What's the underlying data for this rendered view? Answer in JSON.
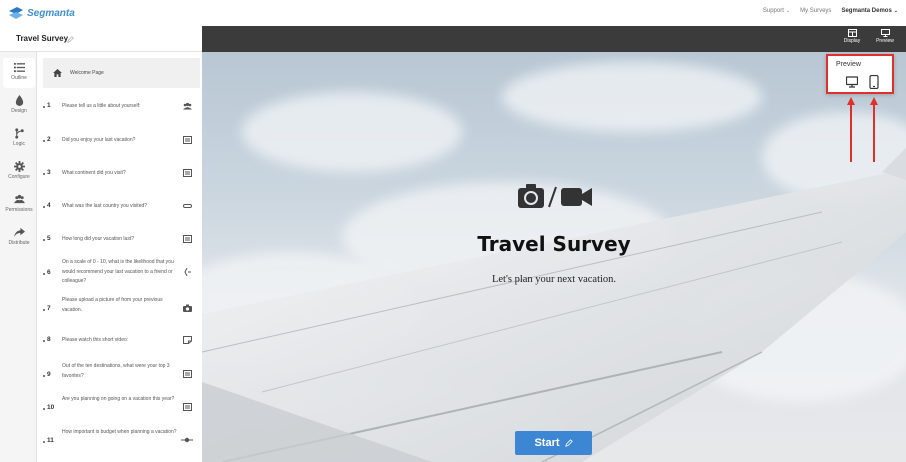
{
  "brand": {
    "name": "Segmanta",
    "color": "#3d8fd6"
  },
  "topnav": {
    "support": "Support",
    "my_surveys": "My Surveys",
    "account": "Segmanta Demos"
  },
  "survey": {
    "title": "Travel Survey"
  },
  "sidenav": [
    {
      "label": "Outline",
      "icon": "outline-icon",
      "active": true
    },
    {
      "label": "Design",
      "icon": "droplet-icon"
    },
    {
      "label": "Logic",
      "icon": "branch-icon"
    },
    {
      "label": "Configure",
      "icon": "gear-icon"
    },
    {
      "label": "Permissions",
      "icon": "users-icon"
    },
    {
      "label": "Distribute",
      "icon": "share-icon"
    }
  ],
  "outline": {
    "welcome": "Welcome Page",
    "questions": [
      {
        "num": "1",
        "text": "Please tell us a little about yourself:",
        "icon": "group-icon"
      },
      {
        "num": "2",
        "text": "Did you enjoy your last vacation?",
        "icon": "list-icon"
      },
      {
        "num": "3",
        "text": "What continent did you visit?",
        "icon": "list-icon"
      },
      {
        "num": "4",
        "text": "What was the last country you visited?",
        "icon": "text-field-icon"
      },
      {
        "num": "5",
        "text": "How long did your vacation last?",
        "icon": "list-icon"
      },
      {
        "num": "6",
        "text": "On a scale of 0 - 10, what is the likelihood that you would recommend your last vacation to a friend or colleague?",
        "icon": "gauge-icon"
      },
      {
        "num": "7",
        "text": "Please upload a picture of from your previous vacation.",
        "icon": "camera-icon"
      },
      {
        "num": "8",
        "text": "Please watch this short video:",
        "icon": "note-icon"
      },
      {
        "num": "9",
        "text": "Out of the ten destinations, what were your top 3 favorites?",
        "icon": "list-icon"
      },
      {
        "num": "10",
        "text": "Are you planning on going on a vacation this year?",
        "icon": "list-icon"
      },
      {
        "num": "11",
        "text": "How important is budget when planning a vacation?",
        "icon": "slider-icon"
      }
    ]
  },
  "stage": {
    "display_label": "Display",
    "preview_label": "Preview"
  },
  "cover": {
    "title": "Travel Survey",
    "subtitle": "Let's plan your next vacation.",
    "start_label": "Start"
  },
  "preview_popover": {
    "title": "Preview",
    "options": [
      "desktop-icon",
      "mobile-icon"
    ],
    "highlight_color": "#e0302a"
  }
}
